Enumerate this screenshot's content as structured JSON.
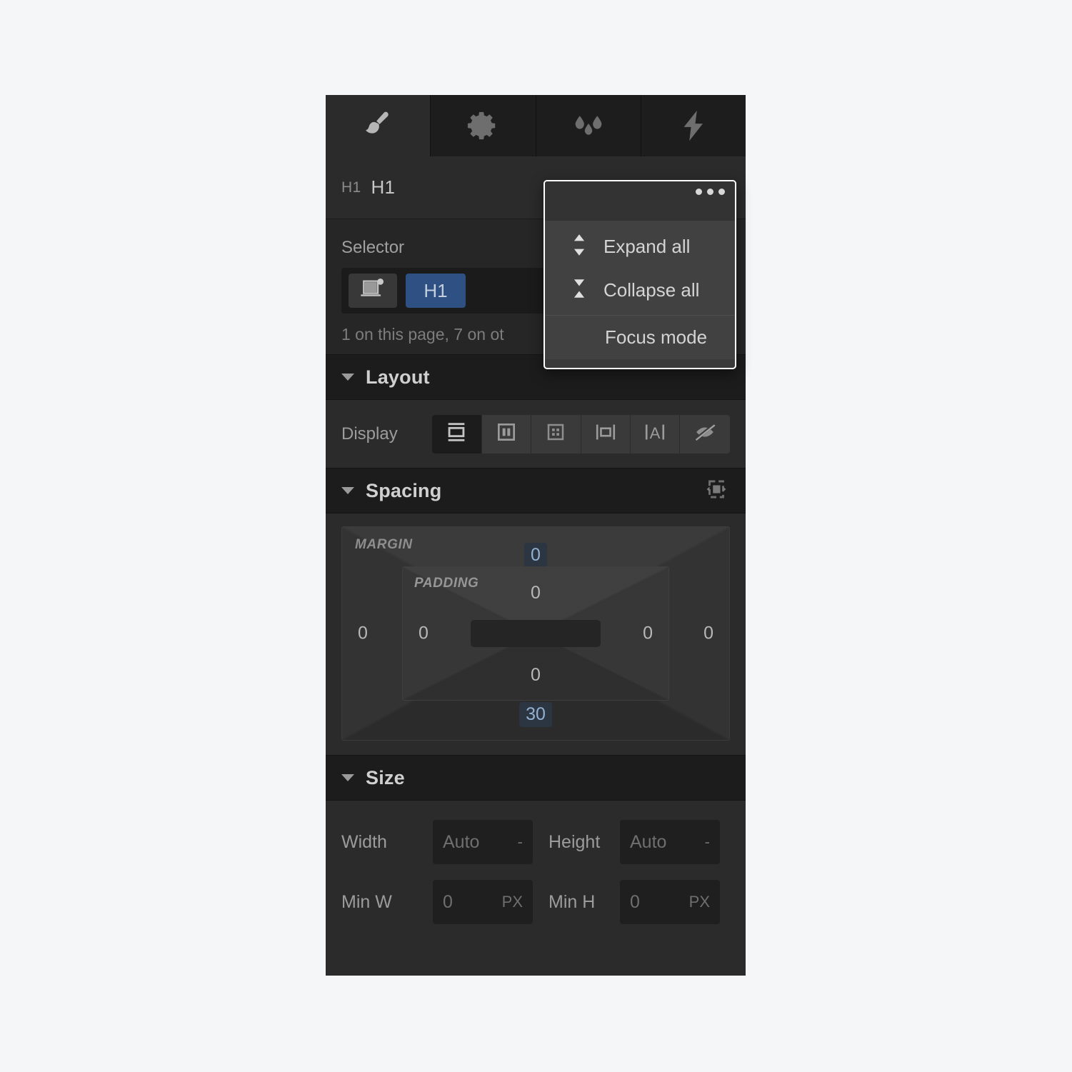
{
  "panel": {
    "tabs": [
      {
        "name": "style-tab",
        "icon": "paint-brush-icon",
        "active": true
      },
      {
        "name": "settings-tab",
        "icon": "gear-icon",
        "active": false
      },
      {
        "name": "style-manager-tab",
        "icon": "water-drops-icon",
        "active": false
      },
      {
        "name": "interactions-tab",
        "icon": "lightning-bolt-icon",
        "active": false
      }
    ],
    "breadcrumb": {
      "parent": "H1",
      "current": "H1"
    },
    "selector": {
      "label": "Selector",
      "device_icon": "device-laptop-icon",
      "tag": "H1",
      "note": "1 on this page, 7 on ot"
    },
    "sections": {
      "layout": {
        "title": "Layout",
        "display": {
          "label": "Display",
          "options": [
            {
              "value": "block",
              "icon": "display-block-icon",
              "selected": true
            },
            {
              "value": "flex",
              "icon": "display-flex-icon",
              "selected": false
            },
            {
              "value": "grid",
              "icon": "display-grid-icon",
              "selected": false
            },
            {
              "value": "inline-block",
              "icon": "display-inline-block-icon",
              "selected": false
            },
            {
              "value": "inline",
              "icon": "display-inline-icon",
              "selected": false
            },
            {
              "value": "none",
              "icon": "display-none-icon",
              "selected": false
            }
          ]
        }
      },
      "spacing": {
        "title": "Spacing",
        "toggle_icon": "spacing-collapse-icon",
        "margin": {
          "label": "MARGIN",
          "top": "0",
          "right": "0",
          "bottom": "30",
          "left": "0"
        },
        "padding": {
          "label": "PADDING",
          "top": "0",
          "right": "0",
          "bottom": "0",
          "left": "0"
        }
      },
      "size": {
        "title": "Size",
        "width": {
          "label": "Width",
          "value": "Auto",
          "unit": "-"
        },
        "height": {
          "label": "Height",
          "value": "Auto",
          "unit": "-"
        },
        "min_width": {
          "label": "Min W",
          "value": "0",
          "unit": "PX"
        },
        "min_height": {
          "label": "Min H",
          "value": "0",
          "unit": "PX"
        }
      }
    }
  },
  "popup": {
    "more_icon": "more-options-dots-icon",
    "items": [
      {
        "label": "Expand all",
        "icon": "expand-all-icon"
      },
      {
        "label": "Collapse all",
        "icon": "collapse-all-icon"
      },
      {
        "label": "Focus mode",
        "icon": ""
      }
    ]
  },
  "colors": {
    "panel_bg": "#2b2b2b",
    "header_bg": "#1c1c1c",
    "tag_blue": "#2f5082",
    "highlight_text": "#93b0d0",
    "popup_border": "#ffffff"
  }
}
